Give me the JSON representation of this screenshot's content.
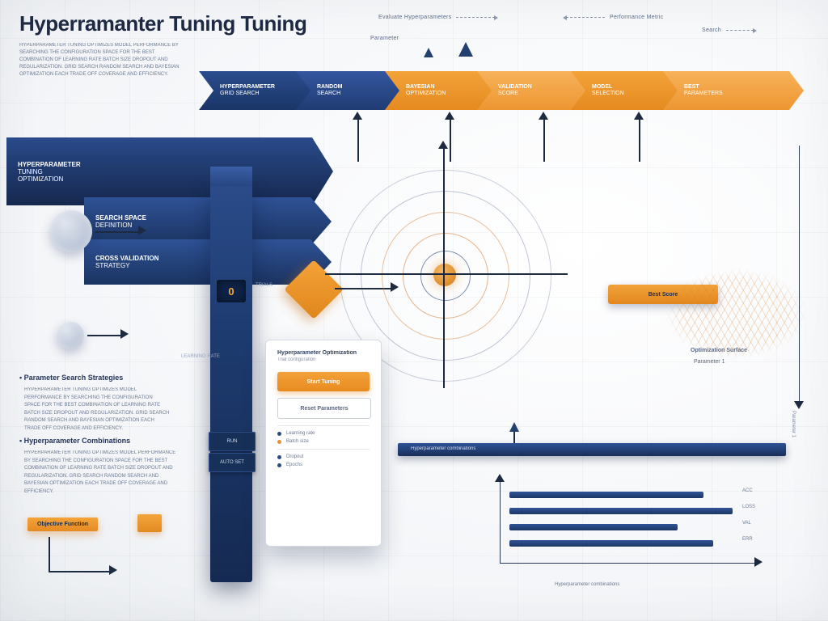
{
  "title": "Hyperramanter Tuning Tuning",
  "legend": {
    "a": "Evaluate Hyperparameters",
    "b": "Parameter",
    "c": "Performance Metric",
    "d": "Search"
  },
  "chevrons": [
    {
      "t1": "HYPERPARAMETER",
      "t2": "GRID SEARCH"
    },
    {
      "t1": "RANDOM",
      "t2": "SEARCH"
    },
    {
      "t1": "BAYESIAN",
      "t2": "OPTIMIZATION"
    },
    {
      "t1": "VALIDATION",
      "t2": "SCORE"
    },
    {
      "t1": "MODEL",
      "t2": "SELECTION"
    },
    {
      "t1": "BEST",
      "t2": "PARAMETERS"
    }
  ],
  "sidebar1": {
    "t1": "HYPERPARAMETER",
    "t2": "TUNING",
    "t3": "OPTIMIZATION"
  },
  "sidebar2": {
    "t1": "SEARCH SPACE",
    "t2": "DEFINITION"
  },
  "sidebar3": {
    "t1": "CROSS VALIDATION",
    "t2": "STRATEGY"
  },
  "pillar_value": "0",
  "pillar_sub": "TRIALS",
  "pillar_btn1": "RUN",
  "pillar_btn2": "AUTO SET",
  "card": {
    "hdr": "Hyperparameter Optimization",
    "sub": "Trial configuration",
    "primary": "Start Tuning",
    "secondary": "Reset Parameters",
    "items": [
      "Learning rate",
      "Batch size",
      "Dropout",
      "Epochs"
    ]
  },
  "callout": "Objective Function",
  "right_label": "Optimization Surface",
  "right_sublabel": "Parameter 1",
  "axis_x": "Hyperparameter combinations",
  "axis_y1": "ACC",
  "axis_y2": "LOSS",
  "axis_y3": "VAL",
  "axis_y4": "ERR",
  "h_orange": "Best Score",
  "left_h1": "• Parameter Search Strategies",
  "left_h2": "• Hyperparameter Combinations",
  "para": "HYPERPARAMETER TUNING OPTIMIZES MODEL PERFORMANCE BY SEARCHING THE CONFIGURATION SPACE FOR THE BEST COMBINATION OF LEARNING RATE BATCH SIZE DROPOUT AND REGULARIZATION. GRID SEARCH RANDOM SEARCH AND BAYESIAN OPTIMIZATION EACH TRADE OFF COVERAGE AND EFFICIENCY.",
  "side_note": "LEARNING RATE"
}
